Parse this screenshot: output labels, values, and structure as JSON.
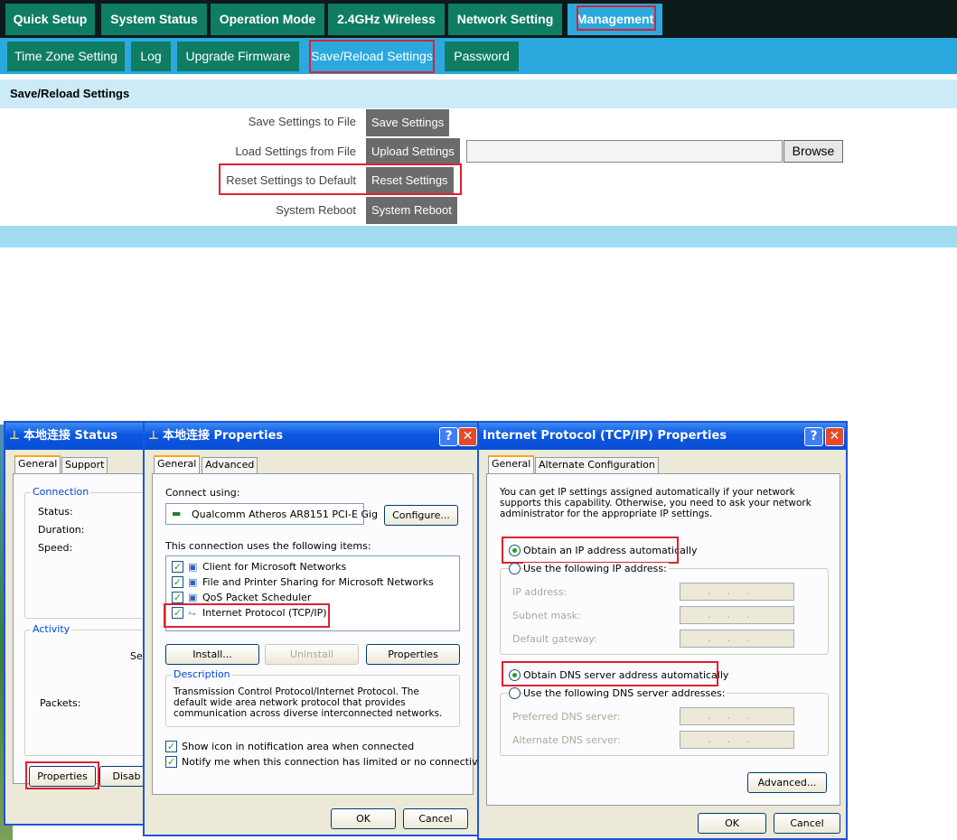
{
  "router": {
    "top_tabs": [
      "Quick Setup",
      "System Status",
      "Operation Mode",
      "2.4GHz Wireless",
      "Network Setting",
      "Management"
    ],
    "sub_tabs": [
      "Time Zone Setting",
      "Log",
      "Upgrade Firmware",
      "Save/Reload Settings",
      "Password"
    ],
    "section_title": "Save/Reload Settings",
    "rows": [
      {
        "label": "Save Settings to File",
        "button": "Save Settings"
      },
      {
        "label": "Load Settings from File",
        "button": "Upload Settings"
      },
      {
        "label": "Reset Settings to Default",
        "button": "Reset Settings"
      },
      {
        "label": "System Reboot",
        "button": "System Reboot"
      }
    ],
    "browse_label": "Browse",
    "colors": {
      "nav_dark": "#0d1a1a",
      "tab_green": "#0f7d63",
      "active_blue": "#2ba9df",
      "button_gray": "#6b6b6b",
      "highlight_red": "#e02030"
    }
  },
  "status_dialog": {
    "title": "本地连接 Status",
    "tabs": [
      "General",
      "Support"
    ],
    "connection_group": "Connection",
    "status_label": "Status:",
    "duration_label": "Duration:",
    "speed_label": "Speed:",
    "activity_group": "Activity",
    "sent_partial": "Ser",
    "packets_label": "Packets:",
    "properties_button": "Properties",
    "disable_partial": "Disab"
  },
  "properties_dialog": {
    "title": "本地连接 Properties",
    "help_btn": "?",
    "close_btn": "✕",
    "tabs": [
      "General",
      "Advanced"
    ],
    "connect_using_label": "Connect using:",
    "adapter": "Qualcomm Atheros AR8151 PCI-E Gig",
    "configure_button": "Configure...",
    "items_label": "This connection uses the following items:",
    "items": [
      "Client for Microsoft Networks",
      "File and Printer Sharing for Microsoft Networks",
      "QoS Packet Scheduler",
      "Internet Protocol (TCP/IP)"
    ],
    "install_button": "Install...",
    "uninstall_button": "Uninstall",
    "properties_button": "Properties",
    "description_group": "Description",
    "description_text": "Transmission Control Protocol/Internet Protocol. The default wide area network protocol that provides communication across diverse interconnected networks.",
    "show_icon_label": "Show icon in notification area when connected",
    "notify_label": "Notify me when this connection has limited or no connectivity",
    "ok_button": "OK",
    "cancel_button": "Cancel"
  },
  "tcpip_dialog": {
    "title": "Internet Protocol (TCP/IP) Properties",
    "help_btn": "?",
    "close_btn": "✕",
    "tabs": [
      "General",
      "Alternate Configuration"
    ],
    "intro_text": "You can get IP settings assigned automatically if your network supports this capability. Otherwise, you need to ask your network administrator for the appropriate IP settings.",
    "obtain_ip_auto": "Obtain an IP address automatically",
    "use_following_ip": "Use the following IP address:",
    "ip_address_label": "IP address:",
    "subnet_mask_label": "Subnet mask:",
    "default_gateway_label": "Default gateway:",
    "obtain_dns_auto": "Obtain DNS server address automatically",
    "use_following_dns": "Use the following DNS server addresses:",
    "preferred_dns_label": "Preferred DNS server:",
    "alternate_dns_label": "Alternate DNS server:",
    "ip_placeholder": "...",
    "advanced_button": "Advanced...",
    "ok_button": "OK",
    "cancel_button": "Cancel"
  }
}
